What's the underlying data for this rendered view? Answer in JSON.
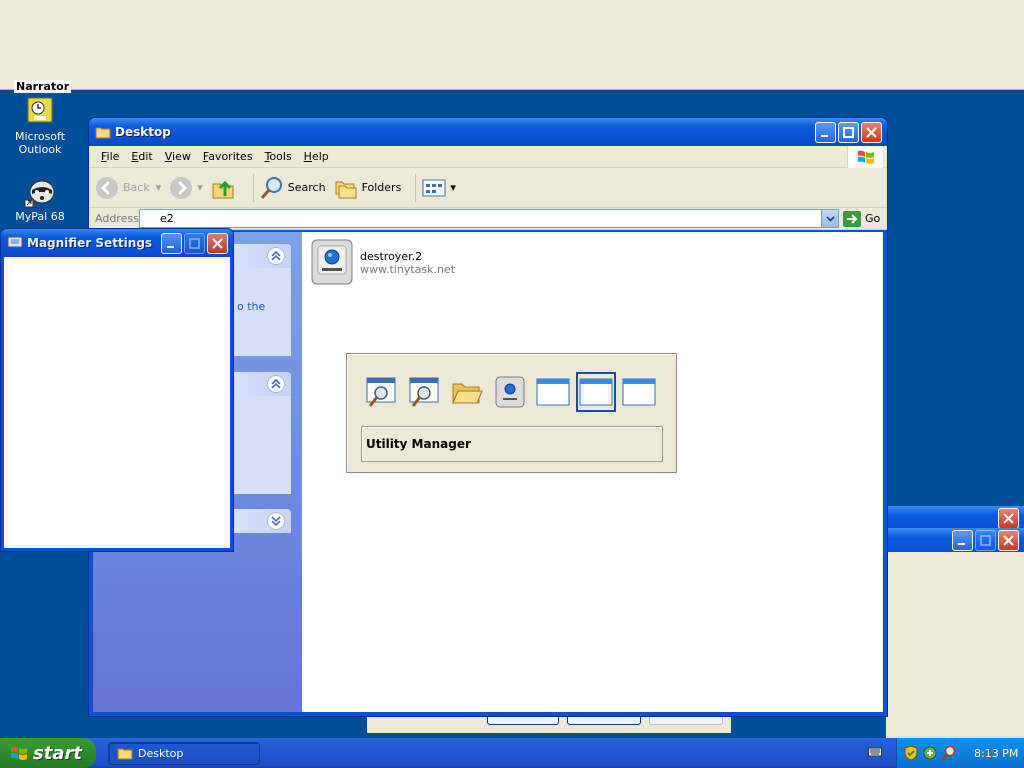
{
  "desktop": {
    "narrator_tooltip": "Narrator",
    "icons": [
      {
        "label_line1": "Microsoft",
        "label_line2": "Outlook",
        "icon": "outlook-icon"
      },
      {
        "label_line1": "MyPal 68",
        "label_line2": "",
        "icon": "raccoon-icon"
      }
    ]
  },
  "explorer": {
    "title": "Desktop",
    "menu": [
      "File",
      "Edit",
      "View",
      "Favorites",
      "Tools",
      "Help"
    ],
    "toolbar": {
      "back": "Back",
      "search": "Search",
      "folders": "Folders"
    },
    "address_label": "Address",
    "address_value": "e2",
    "go_label": "Go",
    "task_link_fragment": "o the",
    "file": {
      "name": "destroyer.2",
      "subtitle": "www.tinytask.net"
    }
  },
  "magnifier": {
    "title": "Magnifier Settings"
  },
  "switcher": {
    "selected_label": "Utility Manager",
    "icons": [
      "magnifier-icon",
      "magnifier-icon",
      "folder-open-icon",
      "tinytask-icon",
      "window-icon",
      "window-icon",
      "window-icon"
    ],
    "selected_index": 5
  },
  "taskbar": {
    "start_label": "start",
    "task_button": "Desktop",
    "clock": "8:13 PM"
  },
  "colors": {
    "desktop": "#004e98",
    "titlebar": "#0b5bdc",
    "taskbar": "#245edb",
    "start": "#2f8b2f"
  }
}
